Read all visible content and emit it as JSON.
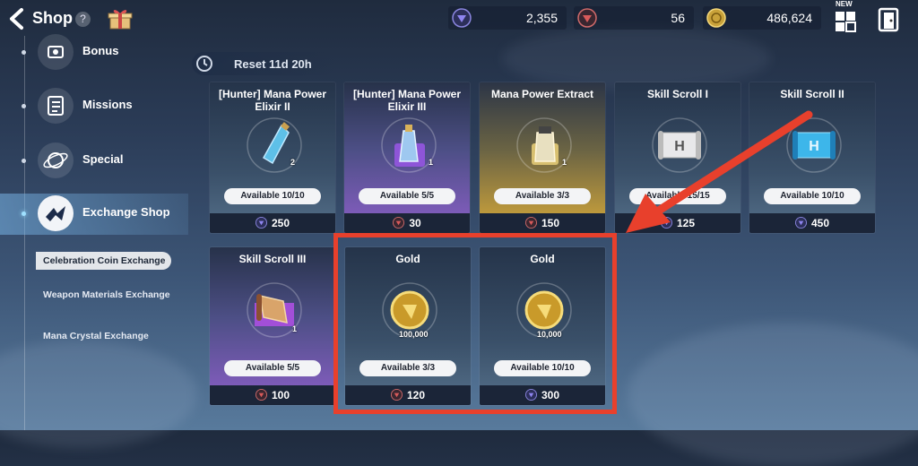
{
  "header": {
    "title": "Shop",
    "help_label": "?",
    "currencies": [
      {
        "icon": "purple-gem-icon",
        "value": "2,355",
        "color": "#6a5cd6"
      },
      {
        "icon": "red-crystal-icon",
        "value": "56",
        "color": "#c84a4a"
      },
      {
        "icon": "gold-coin-icon",
        "value": "486,624",
        "color": "#d9b24a"
      }
    ],
    "new_badge": "NEW"
  },
  "sidebar": {
    "items": [
      {
        "label": "Bonus",
        "icon": "bonus-icon"
      },
      {
        "label": "Missions",
        "icon": "missions-icon"
      },
      {
        "label": "Special",
        "icon": "special-icon"
      },
      {
        "label": "Exchange Shop",
        "icon": "exchange-shop-icon",
        "active": true
      }
    ],
    "subitems": [
      {
        "label": "Celebration Coin Exchange",
        "active": true
      },
      {
        "label": "Weapon Materials Exchange"
      },
      {
        "label": "Mana Crystal Exchange"
      }
    ]
  },
  "reset": {
    "label": "Reset 11d 20h"
  },
  "cards": [
    {
      "name": "[Hunter] Mana Power Elixir II",
      "available": "Available 10/10",
      "price": "250",
      "currency": "purple-gem-icon",
      "qty": "2",
      "style": "blue"
    },
    {
      "name": "[Hunter] Mana Power Elixir III",
      "available": "Available 5/5",
      "price": "30",
      "currency": "red-crystal-icon",
      "qty": "1",
      "style": "purple"
    },
    {
      "name": "Mana Power Extract",
      "available": "Available 3/3",
      "price": "150",
      "currency": "red-crystal-icon",
      "qty": "1",
      "style": "gold"
    },
    {
      "name": "Skill Scroll I",
      "available": "Available 15/15",
      "price": "125",
      "currency": "purple-gem-icon",
      "qty": "",
      "style": "blue"
    },
    {
      "name": "Skill Scroll II",
      "available": "Available 10/10",
      "price": "450",
      "currency": "purple-gem-icon",
      "qty": "",
      "style": "blue"
    },
    {
      "name": "Skill Scroll III",
      "available": "Available 5/5",
      "price": "100",
      "currency": "red-crystal-icon",
      "qty": "1",
      "style": "purple"
    },
    {
      "name": "Gold",
      "available": "Available 3/3",
      "price": "120",
      "currency": "red-crystal-icon",
      "qty": "100,000",
      "style": "blue"
    },
    {
      "name": "Gold",
      "available": "Available 10/10",
      "price": "300",
      "currency": "purple-gem-icon",
      "qty": "10,000",
      "style": "blue"
    }
  ],
  "annotation": {
    "highlight_color": "#e8402c"
  }
}
